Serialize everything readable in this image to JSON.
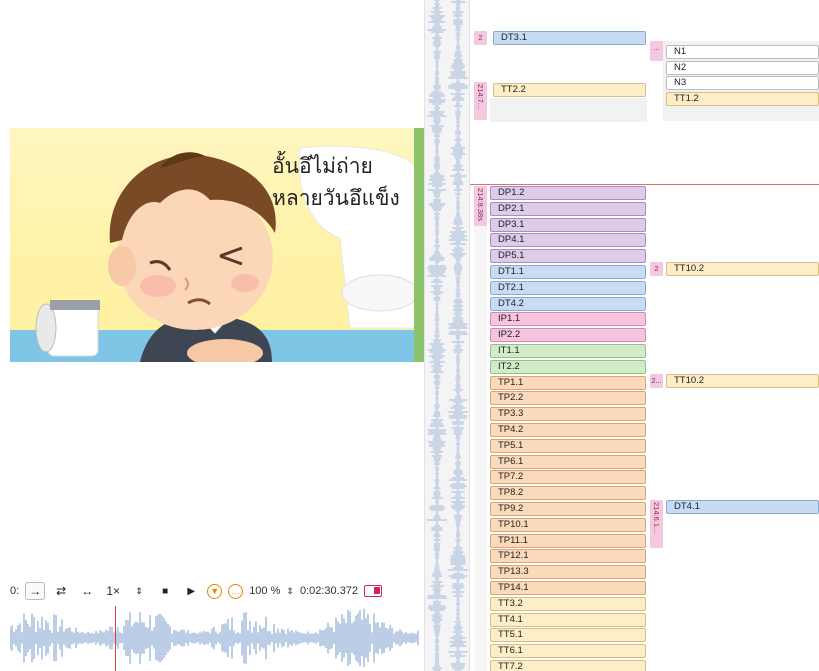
{
  "video": {
    "thai_line1": "อั้นอึไม่ถ่าย",
    "thai_line2": "หลายวันอึแข็ง"
  },
  "transport": {
    "prefix": "0:",
    "arrow_right": "→",
    "loop": "⇄",
    "bidir": "↔",
    "speed": "1×",
    "stepper": "⇕",
    "stop": "■",
    "play": "▶",
    "zoom": "100 %",
    "zoom_stepper": "⇕",
    "timecode": "0:02:30.372"
  },
  "colors": {
    "blue": "#c7dcf3",
    "yellow": "#fdeec7",
    "purple": "#dccbe9",
    "pink": "#f6c4df",
    "green": "#d3ecc8",
    "orange": "#fbd9bb",
    "cursor": "#e04040"
  },
  "tiers": {
    "top_tag1": "2",
    "top_tag2": "214:7...",
    "top_seg1": "DT3.1",
    "top_seg2": "TT2.2",
    "right_tag": "...",
    "right_items": [
      "N1",
      "N2",
      "N3",
      "TT1.2"
    ],
    "main_tag": "214:8.38s",
    "column1": [
      "DP1.2",
      "DP2.1",
      "DP3.1",
      "DP4.1",
      "DP5.1",
      "DT1.1",
      "DT2.1",
      "DT4.2",
      "IP1.1",
      "IP2.2",
      "IT1.1",
      "IT2.2",
      "TP1.1",
      "TP2.2",
      "TP3.3",
      "TP4.2",
      "TP5.1",
      "TP6.1",
      "TP7.2",
      "TP8.2",
      "TP9.2",
      "TP10.1",
      "TP11.1",
      "TP12.1",
      "TP13.3",
      "TP14.1",
      "TT3.2",
      "TT4.1",
      "TT5.1",
      "TT6.1",
      "TT7.2"
    ],
    "col2_a_tag": "2",
    "col2_a": "TT10.2",
    "col2_b_tag": "2...",
    "col2_b": "TT10.2",
    "col2_c_tag": "214:6.1...",
    "col2_c": "DT4.1"
  }
}
